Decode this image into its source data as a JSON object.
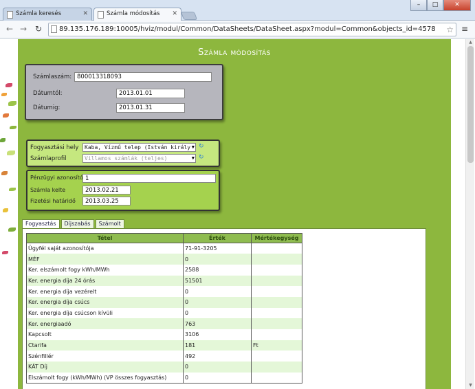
{
  "browser": {
    "tabs": [
      {
        "title": "Számla keresés",
        "active": false
      },
      {
        "title": "Számla módosítás",
        "active": true
      }
    ],
    "url": "89.135.176.189:10005/hviz/modul/Common/DataSheets/DataSheet.aspx?modul=Common&objects_id=4578",
    "window_buttons": {
      "minimize": "–",
      "maximize": "□",
      "close": "✕"
    }
  },
  "page": {
    "title": "Számla módosítás",
    "bg_color": "#8db73e",
    "invoice": {
      "number_label": "Számlaszám:",
      "number_value": "800013318093",
      "date_from_label": "Dátumtól:",
      "date_from_value": "2013.01.01",
      "date_to_label": "Dátumig:",
      "date_to_value": "2013.01.31"
    },
    "location": {
      "place_label": "Fogyasztási hely",
      "place_value": "Kaba, Vízmű telep (István király",
      "profile_label": "Számlaprofil",
      "profile_value": "Villamos számlák (teljes)"
    },
    "finance": {
      "id_label": "Pénzügyi azonosító",
      "id_value": "1",
      "issue_label": "Számla kelte",
      "issue_value": "2013.02.21",
      "due_label": "Fizetési határidő",
      "due_value": "2013.03.25"
    },
    "tabs": [
      "Fogyasztás",
      "Díjszabás",
      "Számolt"
    ],
    "table": {
      "headers": [
        "Tétel",
        "Érték",
        "Mértékegység"
      ],
      "rows": [
        [
          "Ügyfél saját azonosítója",
          "71-91-3205",
          ""
        ],
        [
          "MÉF",
          "0",
          ""
        ],
        [
          "Ker. elszámolt fogy kWh/MWh",
          "2588",
          ""
        ],
        [
          "Ker. energia díja 24 órás",
          "51501",
          ""
        ],
        [
          "Ker. energia díja vezérelt",
          "0",
          ""
        ],
        [
          "Ker. energia díja csúcs",
          "0",
          ""
        ],
        [
          "Ker. energia díja csúcson kívüli",
          "0",
          ""
        ],
        [
          "Ker. energiaadó",
          "763",
          ""
        ],
        [
          "Kapcsolt",
          "3106",
          ""
        ],
        [
          "Ctarifa",
          "181",
          "Ft"
        ],
        [
          "Szénfillér",
          "492",
          ""
        ],
        [
          "KÁT Díj",
          "0",
          ""
        ],
        [
          "Elszámolt fogy (kWh/MWh) (VP összes fogyasztás)",
          "0",
          ""
        ]
      ]
    }
  }
}
